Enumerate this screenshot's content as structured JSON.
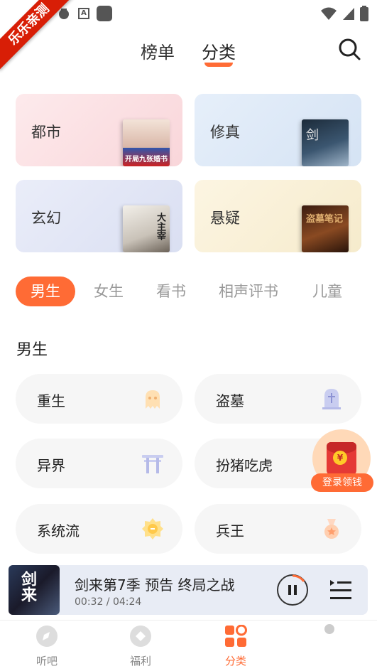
{
  "status_bar": {
    "ribbon_text": "乐乐亲测",
    "a_label": "A"
  },
  "header": {
    "tabs": [
      "榜单",
      "分类"
    ],
    "active_tab": "分类"
  },
  "category_cards": [
    {
      "label": "都市",
      "bg": "#fde6e8"
    },
    {
      "label": "修真",
      "bg": "#e4eef9"
    },
    {
      "label": "玄幻",
      "bg": "#e8ecf8"
    },
    {
      "label": "悬疑",
      "bg": "#fbf3dc"
    }
  ],
  "cover_texts": {
    "dushi": "开局九张婚书",
    "xiuzhen": "剑",
    "xuanhuan": "大主宰",
    "xuanyi": "盗墓笔记"
  },
  "filters": [
    "男生",
    "女生",
    "看书",
    "相声评书",
    "儿童"
  ],
  "active_filter": "男生",
  "section": {
    "title": "男生"
  },
  "genres": [
    {
      "label": "重生",
      "icon": "ghost-icon"
    },
    {
      "label": "盗墓",
      "icon": "tombstone-icon"
    },
    {
      "label": "异界",
      "icon": "torii-gate-icon"
    },
    {
      "label": "扮猪吃虎",
      "icon": "pig-icon"
    },
    {
      "label": "系统流",
      "icon": "gear-badge-icon"
    },
    {
      "label": "兵王",
      "icon": "medal-icon"
    }
  ],
  "promo": {
    "label": "登录领钱",
    "coin": "¥"
  },
  "player": {
    "title": "剑来第7季 预告 终局之战",
    "time": "00:32 / 04:24",
    "cover_text": "剑来"
  },
  "tabbar": {
    "items": [
      "听吧",
      "福利",
      "分类"
    ],
    "active": "分类"
  },
  "colors": {
    "accent": "#ff6b35",
    "pill_bg": "#f6f6f6",
    "player_bg": "#e8ecf5",
    "ribbon": "#d81e06"
  }
}
